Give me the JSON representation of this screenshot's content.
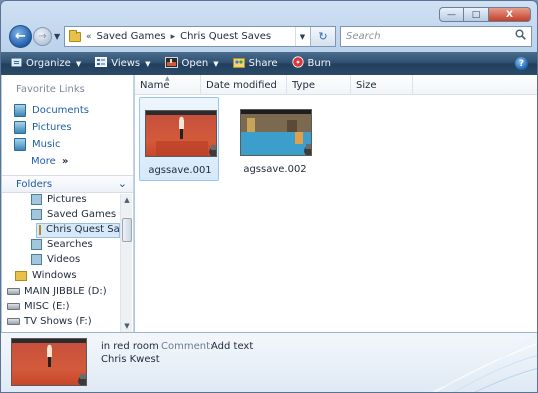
{
  "window": {
    "caption_buttons": {
      "minimize": "—",
      "maximize": "□",
      "close": "X"
    }
  },
  "navigation": {
    "back": "←",
    "forward": "→",
    "history_dropdown": "▼"
  },
  "address_bar": {
    "separator": "«",
    "crumbs": [
      "Saved Games",
      "Chris Quest Saves"
    ],
    "crumb_arrow": "▸",
    "dropdown": "▼",
    "refresh": "↻"
  },
  "search": {
    "placeholder": "Search",
    "icon": "search-icon"
  },
  "command_bar": {
    "organize": "Organize",
    "views": "Views",
    "open": "Open",
    "share": "Share",
    "burn": "Burn",
    "help": "?",
    "dropdown": "▼"
  },
  "nav_pane": {
    "favorites_header": "Favorite Links",
    "favorites": [
      "Documents",
      "Pictures",
      "Music"
    ],
    "more": "More",
    "more_arrow": "»",
    "folders_label": "Folders",
    "folders_chevron": "⌄",
    "tree": [
      "Pictures",
      "Saved Games",
      "Chris Quest Sav",
      "Searches",
      "Videos",
      "Windows",
      "MAIN JIBBLE (D:)",
      "MISC (E:)",
      "TV Shows (F:)"
    ],
    "scroll_up": "▲",
    "scroll_down": "▼"
  },
  "columns": [
    "Name",
    "Date modified",
    "Type",
    "Size"
  ],
  "sort_indicator": "▲",
  "files": [
    {
      "name": "agssave.001",
      "selected": true
    },
    {
      "name": "agssave.002",
      "selected": false
    }
  ],
  "details": {
    "title": "in red room",
    "comment_label": "Comment:",
    "comment_value": "Add text",
    "author": "Chris Kwest"
  }
}
